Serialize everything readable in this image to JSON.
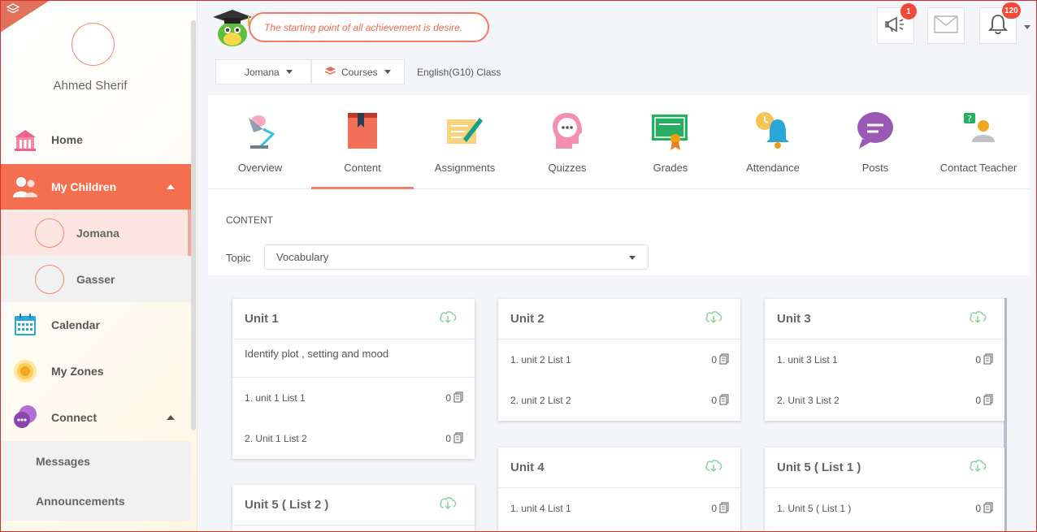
{
  "sidebar": {
    "user_name": "Ahmed Sherif",
    "items": {
      "home": "Home",
      "my_children": "My Children",
      "calendar": "Calendar",
      "my_zones": "My Zones",
      "connect": "Connect"
    },
    "children": [
      "Jomana",
      "Gasser"
    ],
    "connect_sub": [
      "Messages",
      "Announcements"
    ]
  },
  "header": {
    "quote": "The starting point of all achievement is desire.",
    "announcements_badge": "1",
    "notifications_badge": "120"
  },
  "breadcrumb": {
    "child": "Jomana",
    "courses": "Courses",
    "current": "English(G10) Class"
  },
  "tabs": [
    "Overview",
    "Content",
    "Assignments",
    "Quizzes",
    "Grades",
    "Attendance",
    "Posts",
    "Contact Teacher"
  ],
  "active_tab": "Content",
  "content": {
    "section_title": "CONTENT",
    "topic_label": "Topic",
    "topic_value": "Vocabulary",
    "units": [
      {
        "title": "Unit 1",
        "description": "Identify plot , setting and mood",
        "lists": [
          {
            "name": "1. unit 1 List 1",
            "count": "0"
          },
          {
            "name": "2. Unit 1 List 2",
            "count": "0"
          }
        ]
      },
      {
        "title": "Unit 2",
        "lists": [
          {
            "name": "1. unit 2 List 1",
            "count": "0"
          },
          {
            "name": "2. unit 2 List 2",
            "count": "0"
          }
        ]
      },
      {
        "title": "Unit 3",
        "lists": [
          {
            "name": "1. unit 3 List 1",
            "count": "0"
          },
          {
            "name": "2. Unit 3 List 2",
            "count": "0"
          }
        ]
      },
      {
        "title": "Unit 4",
        "lists": [
          {
            "name": "1. unit 4 List 1",
            "count": "0"
          }
        ]
      },
      {
        "title": "Unit 5 ( List 1 )",
        "lists": [
          {
            "name": "1. Unit 5 ( List 1 )",
            "count": "0"
          }
        ]
      },
      {
        "title": "Unit 5 ( List 2 )",
        "lists": []
      }
    ]
  },
  "colors": {
    "accent": "#f36f50",
    "badge": "#f3473a",
    "cloud": "#8fd19e"
  }
}
